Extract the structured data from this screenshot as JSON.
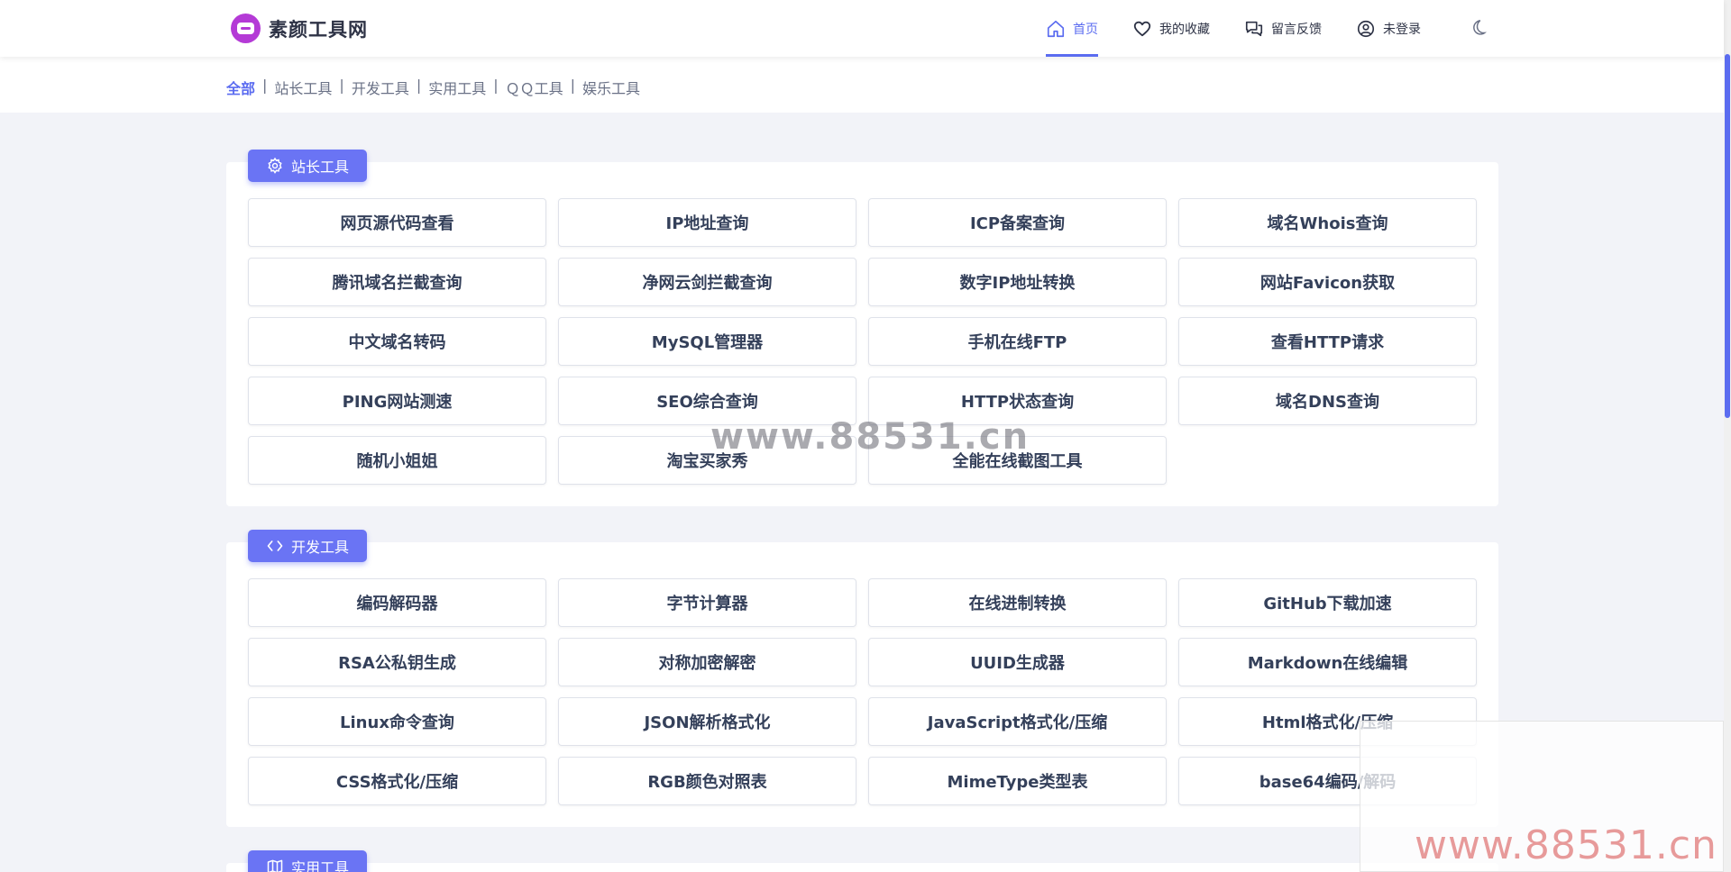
{
  "brand": {
    "name": "素颜工具网",
    "icon": "logo-icon",
    "color": "#b43ad6"
  },
  "nav": [
    {
      "label": "首页",
      "icon": "home-icon",
      "active": true
    },
    {
      "label": "我的收藏",
      "icon": "heart-icon"
    },
    {
      "label": "留言反馈",
      "icon": "chat-icon"
    },
    {
      "label": "未登录",
      "icon": "user-icon"
    }
  ],
  "theme_toggle": {
    "icon": "moon-icon"
  },
  "categories": {
    "items": [
      "全部",
      "站长工具",
      "开发工具",
      "实用工具",
      "ＱＱ工具",
      "娱乐工具"
    ],
    "separator": "|"
  },
  "sections": [
    {
      "label": "站长工具",
      "icon": "gear-icon",
      "tools": [
        "网页源代码查看",
        "IP地址查询",
        "ICP备案查询",
        "域名Whois查询",
        "腾讯域名拦截查询",
        "净网云剑拦截查询",
        "数字IP地址转换",
        "网站Favicon获取",
        "中文域名转码",
        "MySQL管理器",
        "手机在线FTP",
        "查看HTTP请求",
        "PING网站测速",
        "SEO综合查询",
        "HTTP状态查询",
        "域名DNS查询",
        "随机小姐姐",
        "淘宝买家秀",
        "全能在线截图工具"
      ]
    },
    {
      "label": "开发工具",
      "icon": "code-icon",
      "tools": [
        "编码解码器",
        "字节计算器",
        "在线进制转换",
        "GitHub下载加速",
        "RSA公私钥生成",
        "对称加密解密",
        "UUID生成器",
        "Markdown在线编辑",
        "Linux命令查询",
        "JSON解析格式化",
        "JavaScript格式化/压缩",
        "Html格式化/压缩",
        "CSS格式化/压缩",
        "RGB颜色对照表",
        "MimeType类型表",
        "base64编码/解码"
      ]
    },
    {
      "label": "实用工具",
      "icon": "map-icon",
      "tools": []
    }
  ],
  "watermarks": {
    "center": "www.88531.cn",
    "corner": "www.88531.cn"
  },
  "colors": {
    "accent": "#5b6cf0",
    "label_bg": "#6a74f4"
  }
}
